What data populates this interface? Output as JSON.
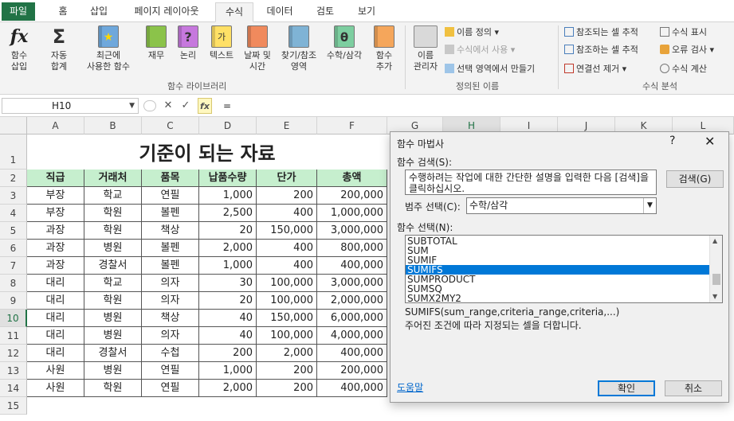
{
  "tabs": [
    "파일",
    "홈",
    "삽입",
    "페이지 레이아웃",
    "수식",
    "데이터",
    "검토",
    "보기"
  ],
  "ribbon": {
    "insert_function": "함수\n삽입",
    "autosum": "자동\n합계",
    "recent": "최근에\n사용한 함수",
    "financial": "재무",
    "logical": "논리",
    "text": "텍스트",
    "datetime": "날짜 및\n시간",
    "lookup": "찾기/참조\n영역",
    "math": "수학/삼각",
    "more": "함수\n추가",
    "group_library": "함수 라이브러리",
    "name_manager": "이름\n관리자",
    "define_name": "이름 정의",
    "use_in_formula": "수식에서 사용",
    "create_from_selection": "선택 영역에서 만들기",
    "group_defined_names": "정의된 이름",
    "trace_precedents": "참조되는 셀 추적",
    "trace_dependents": "참조하는 셀 추적",
    "remove_arrows": "연결선 제거",
    "show_formulas": "수식 표시",
    "error_checking": "오류 검사",
    "evaluate_formula": "수식 계산",
    "group_auditing": "수식 분석"
  },
  "formula_bar": {
    "name_box": "H10",
    "formula": "="
  },
  "columns": [
    "A",
    "B",
    "C",
    "D",
    "E",
    "F",
    "G",
    "H",
    "I",
    "J",
    "K",
    "L"
  ],
  "rows": [
    "1",
    "2",
    "3",
    "4",
    "5",
    "6",
    "7",
    "8",
    "9",
    "10",
    "11",
    "12",
    "13",
    "14",
    "15"
  ],
  "sheet": {
    "title": "기준이 되는 자료",
    "headers": [
      "직급",
      "거래처",
      "품목",
      "납품수량",
      "단가",
      "총액"
    ],
    "data": [
      [
        "부장",
        "학교",
        "연필",
        "1,000",
        "200",
        "200,000"
      ],
      [
        "부장",
        "학원",
        "볼펜",
        "2,500",
        "400",
        "1,000,000"
      ],
      [
        "과장",
        "학원",
        "책상",
        "20",
        "150,000",
        "3,000,000"
      ],
      [
        "과장",
        "병원",
        "볼펜",
        "2,000",
        "400",
        "800,000"
      ],
      [
        "과장",
        "경찰서",
        "볼펜",
        "1,000",
        "400",
        "400,000"
      ],
      [
        "대리",
        "학교",
        "의자",
        "30",
        "100,000",
        "3,000,000"
      ],
      [
        "대리",
        "학원",
        "의자",
        "20",
        "100,000",
        "2,000,000"
      ],
      [
        "대리",
        "병원",
        "책상",
        "40",
        "150,000",
        "6,000,000"
      ],
      [
        "대리",
        "병원",
        "의자",
        "40",
        "100,000",
        "4,000,000"
      ],
      [
        "대리",
        "경찰서",
        "수첩",
        "200",
        "2,000",
        "400,000"
      ],
      [
        "사원",
        "병원",
        "연필",
        "1,000",
        "200",
        "200,000"
      ],
      [
        "사원",
        "학원",
        "연필",
        "2,000",
        "200",
        "400,000"
      ]
    ]
  },
  "dialog": {
    "title": "함수 마법사",
    "help": "?",
    "close": "✕",
    "search_label": "함수 검색(S):",
    "search_text": "수행하려는 작업에 대한 간단한 설명을 입력한 다음 [검색]을 클릭하십시오.",
    "search_button": "검색(G)",
    "category_label": "범주 선택(C):",
    "category_value": "수학/삼각",
    "function_label": "함수 선택(N):",
    "functions": [
      "SUBTOTAL",
      "SUM",
      "SUMIF",
      "SUMIFS",
      "SUMPRODUCT",
      "SUMSQ",
      "SUMX2MY2"
    ],
    "selected_function": "SUMIFS",
    "syntax": "SUMIFS(sum_range,criteria_range,criteria,...)",
    "description": "주어진 조건에 따라 지정되는 셀을 더합니다.",
    "help_link": "도움말",
    "ok": "확인",
    "cancel": "취소"
  },
  "colors": {
    "excel_green": "#217346",
    "header_fill": "#c6efce",
    "selection_blue": "#0078d7"
  }
}
